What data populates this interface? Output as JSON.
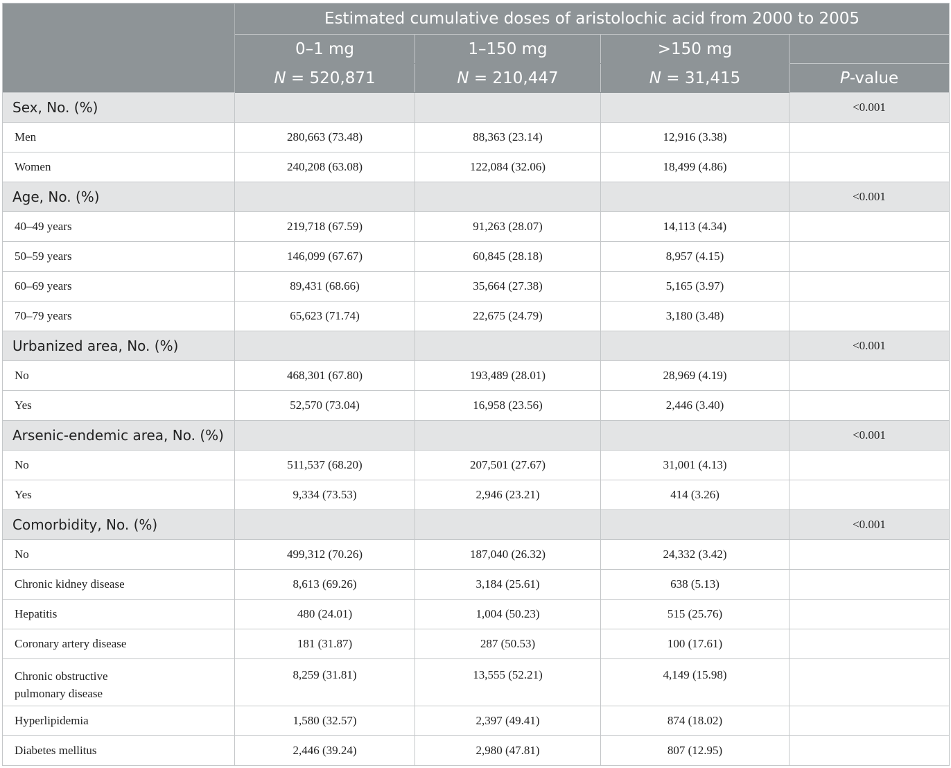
{
  "header": {
    "title": "Estimated cumulative doses of aristolochic acid from 2000 to 2005",
    "dose_ranges": [
      "0–1 mg",
      "1–150 mg",
      ">150 mg"
    ],
    "n_prefix": "N",
    "n_values": [
      "= 520,871",
      "= 210,447",
      "= 31,415"
    ],
    "pvalue_italic": "P",
    "pvalue_rest": "-value"
  },
  "sections": [
    {
      "label": "Sex, No. (%)",
      "p": "<0.001",
      "rows": [
        {
          "label": "Men",
          "v1": "280,663 (73.48)",
          "v2": "88,363 (23.14)",
          "v3": "12,916 (3.38)"
        },
        {
          "label": "Women",
          "v1": "240,208 (63.08)",
          "v2": "122,084 (32.06)",
          "v3": "18,499 (4.86)"
        }
      ]
    },
    {
      "label": "Age, No. (%)",
      "p": "<0.001",
      "rows": [
        {
          "label": "40–49 years",
          "v1": "219,718 (67.59)",
          "v2": "91,263 (28.07)",
          "v3": "14,113 (4.34)"
        },
        {
          "label": "50–59 years",
          "v1": "146,099 (67.67)",
          "v2": "60,845 (28.18)",
          "v3": "8,957 (4.15)"
        },
        {
          "label": "60–69 years",
          "v1": "89,431 (68.66)",
          "v2": "35,664 (27.38)",
          "v3": "5,165 (3.97)"
        },
        {
          "label": "70–79 years",
          "v1": "65,623 (71.74)",
          "v2": "22,675 (24.79)",
          "v3": "3,180 (3.48)"
        }
      ]
    },
    {
      "label": "Urbanized area, No. (%)",
      "p": "<0.001",
      "rows": [
        {
          "label": "No",
          "v1": "468,301 (67.80)",
          "v2": "193,489 (28.01)",
          "v3": "28,969 (4.19)"
        },
        {
          "label": "Yes",
          "v1": "52,570 (73.04)",
          "v2": "16,958 (23.56)",
          "v3": "2,446 (3.40)"
        }
      ]
    },
    {
      "label": "Arsenic-endemic area, No. (%)",
      "p": "<0.001",
      "rows": [
        {
          "label": "No",
          "v1": "511,537 (68.20)",
          "v2": "207,501 (27.67)",
          "v3": "31,001 (4.13)"
        },
        {
          "label": "Yes",
          "v1": "9,334 (73.53)",
          "v2": "2,946 (23.21)",
          "v3": "414 (3.26)"
        }
      ]
    },
    {
      "label": "Comorbidity, No. (%)",
      "p": "<0.001",
      "rows": [
        {
          "label": "No",
          "v1": "499,312 (70.26)",
          "v2": "187,040 (26.32)",
          "v3": "24,332 (3.42)"
        },
        {
          "label": "Chronic kidney disease",
          "v1": "8,613 (69.26)",
          "v2": "3,184 (25.61)",
          "v3": "638 (5.13)"
        },
        {
          "label": "Hepatitis",
          "v1": "480 (24.01)",
          "v2": "1,004 (50.23)",
          "v3": "515 (25.76)"
        },
        {
          "label": "Coronary artery disease",
          "v1": "181 (31.87)",
          "v2": "287 (50.53)",
          "v3": "100 (17.61)"
        },
        {
          "label": "Chronic obstructive",
          "label2": "pulmonary disease",
          "v1": "8,259 (31.81)",
          "v2": "13,555 (52.21)",
          "v3": "4,149 (15.98)"
        },
        {
          "label": "Hyperlipidemia",
          "v1": "1,580 (32.57)",
          "v2": "2,397 (49.41)",
          "v3": "874 (18.02)"
        },
        {
          "label": "Diabetes mellitus",
          "v1": "2,446 (39.24)",
          "v2": "2,980 (47.81)",
          "v3": "807 (12.95)"
        }
      ]
    }
  ]
}
